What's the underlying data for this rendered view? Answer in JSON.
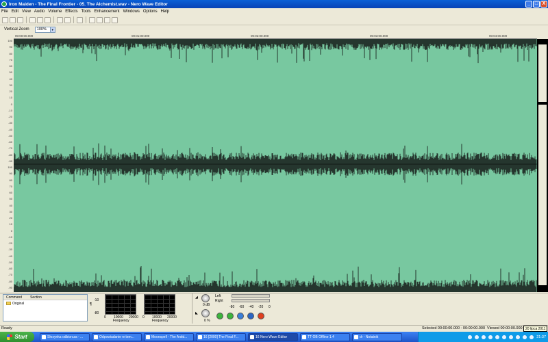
{
  "window": {
    "title": "Iron Maiden - The Final Frontier - 05. The Alchemist.wav - Nero Wave Editor",
    "controls": [
      "_",
      "□",
      "X"
    ]
  },
  "menu": [
    "File",
    "Edit",
    "View",
    "Audio",
    "Volume",
    "Effects",
    "Tools",
    "Enhancement",
    "Windows",
    "Options",
    "Help"
  ],
  "zoom": {
    "label": "Vertical Zoom",
    "value": "100%"
  },
  "ruler": [
    "00:00:00.000",
    "00:01:00.000",
    "00:02:00.000",
    "00:03:00.000",
    "00:04:00.000"
  ],
  "yaxis": [
    "100",
    "90",
    "80",
    "70",
    "60",
    "50",
    "40",
    "30",
    "20",
    "10",
    "0",
    "-10",
    "-20",
    "-30",
    "-40",
    "-50",
    "-60",
    "-70",
    "-80",
    "-90",
    "100",
    "90",
    "80",
    "70",
    "60",
    "50",
    "40",
    "30",
    "20",
    "10",
    "0",
    "-10",
    "-20",
    "-30",
    "-40",
    "-50",
    "-60",
    "-70",
    "-80",
    "-90"
  ],
  "history": {
    "columns": [
      "Command",
      "Section"
    ],
    "rows": [
      {
        "command": "Original",
        "section": ""
      }
    ]
  },
  "spectrum": {
    "db_top": "-10",
    "db_bottom": "-80",
    "freq_ticks": [
      "0",
      "10000",
      "20000"
    ],
    "freq_ticks2": [
      "0",
      "10000",
      "20000"
    ],
    "freq_label": "Frequency"
  },
  "transport": {
    "left": "Left",
    "right": "Right",
    "db": "0 dB",
    "pct": "0 %",
    "scale": [
      "-80",
      "-60",
      "-40",
      "-20",
      "0"
    ]
  },
  "status": {
    "ready": "Ready",
    "selected": "Selected 00:00:00.000 - 00:00:00.000",
    "viewed": "Viewed 00:00:00.000 - 00:"
  },
  "taskbar": {
    "start": "Start",
    "tasks": [
      "Skrzynka odbiorcza - ...",
      "Odpowiadanie w tem...",
      "Moonspell - The Antid...",
      "16 [2000] The Final F...",
      "16 Nero Wave Editor",
      "TT-OB Offline 1.4",
      "dr - Notatnik"
    ],
    "clock": "21:37",
    "date_tooltip": "20 lipca 2011"
  }
}
